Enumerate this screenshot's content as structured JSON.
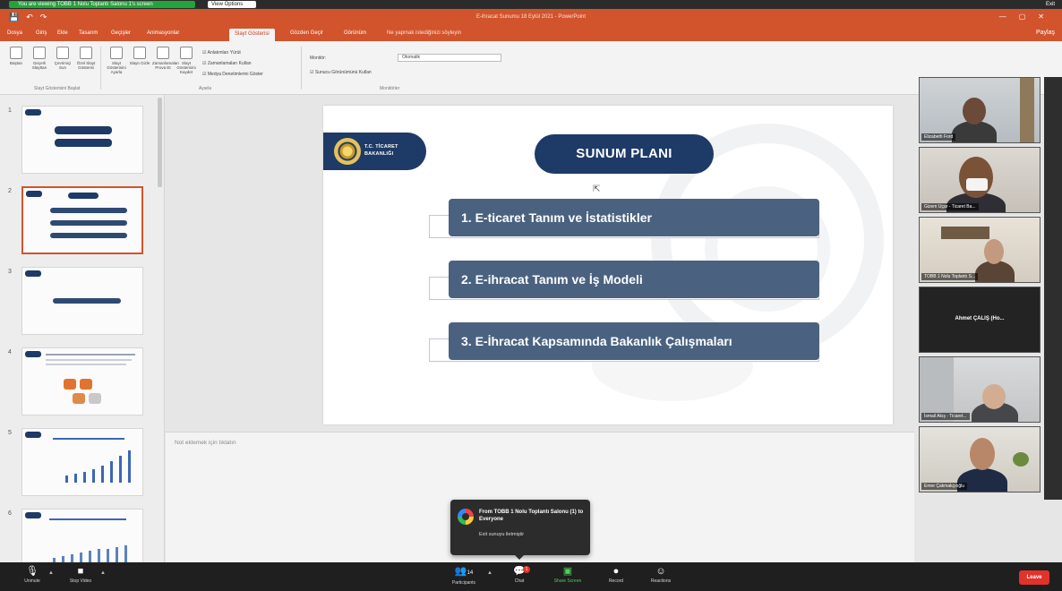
{
  "zoom": {
    "share_banner": "You are viewing TOBB 1 Nolu Toplantı Salonu 1's screen",
    "view_options": "View Options",
    "top_right": "Exit",
    "chat": {
      "from": "From TOBB 1 Nolu Toplantı Salonu (1) to Everyone",
      "message": "Exit sunuyu iletmiştir"
    },
    "toolbar": {
      "unmute": "Unmute",
      "stop_video": "Stop Video",
      "participants": "Participants",
      "participants_count": "14",
      "chat": "Chat",
      "chat_badge": "1",
      "share_screen": "Share Screen",
      "record": "Record",
      "reactions": "Reactions",
      "end": "Leave"
    }
  },
  "ppt": {
    "qat_save": "💾",
    "qat_undo": "↶",
    "qat_redo": "↷",
    "title": "E-ihracat Sunumu 18 Eylül 2021 - PowerPoint",
    "win_min": "—",
    "win_max": "▢",
    "win_close": "✕",
    "tabs": [
      "Dosya",
      "Giriş",
      "Ekle",
      "Tasarım",
      "Geçişler",
      "Animasyonlar",
      "Slayt Gösterisi",
      "Gözden Geçir",
      "Görünüm"
    ],
    "active_tab_index": 6,
    "tell_me": "Ne yapmak istediğinizi söyleyin",
    "share": "Paylaş",
    "ribbon": {
      "buttons": [
        "Baştan",
        "Geçerli Slayttan",
        "Çevrimiçi Sun",
        "Özel Slayt Gösterisi",
        "Slayt Gösterisini Ayarla",
        "Slaytı Gizle",
        "Zamanlamaları Prova Et",
        "Slayt Gösterisini Kaydet"
      ],
      "checks": [
        "Anlatımları Yürüt",
        "Zamanlamaları Kullan",
        "Medya Denetimlerini Göster"
      ],
      "monitor_label": "Monitör:",
      "monitor_value": "Otomatik",
      "presenter_check": "Sunucu Görünümünü Kullan",
      "groups": [
        "Slayt Gösterisini Başlat",
        "Ayarla",
        "Monitörler"
      ]
    },
    "thumb_numbers": [
      "1",
      "2",
      "3",
      "4",
      "5",
      "6"
    ],
    "notes_placeholder": "Not eklemek için tıklatın"
  },
  "slide": {
    "logo_line1": "T.C. TİCARET",
    "logo_line2": "BAKANLIĞI",
    "title": "SUNUM PLANI",
    "items": [
      "1. E-ticaret Tanım ve İstatistikler",
      "2. E-ihracat Tanım ve İş Modeli",
      "3. E-İhracat Kapsamında Bakanlık Çalışmaları"
    ]
  },
  "participants": [
    {
      "name": "Elizabeth Ford",
      "kind": "video"
    },
    {
      "name": "Gizem Uçar - Ticaret Ba...",
      "kind": "video"
    },
    {
      "name": "TOBB 1 Nolu Toplantı S...",
      "kind": "video"
    },
    {
      "name": "Ahmet ÇALIŞ (Ho...",
      "kind": "name"
    },
    {
      "name": "İsmail Akış - Ticaret...",
      "kind": "video"
    },
    {
      "name": "Emre Çakmakçıoğlu",
      "kind": "video"
    }
  ]
}
